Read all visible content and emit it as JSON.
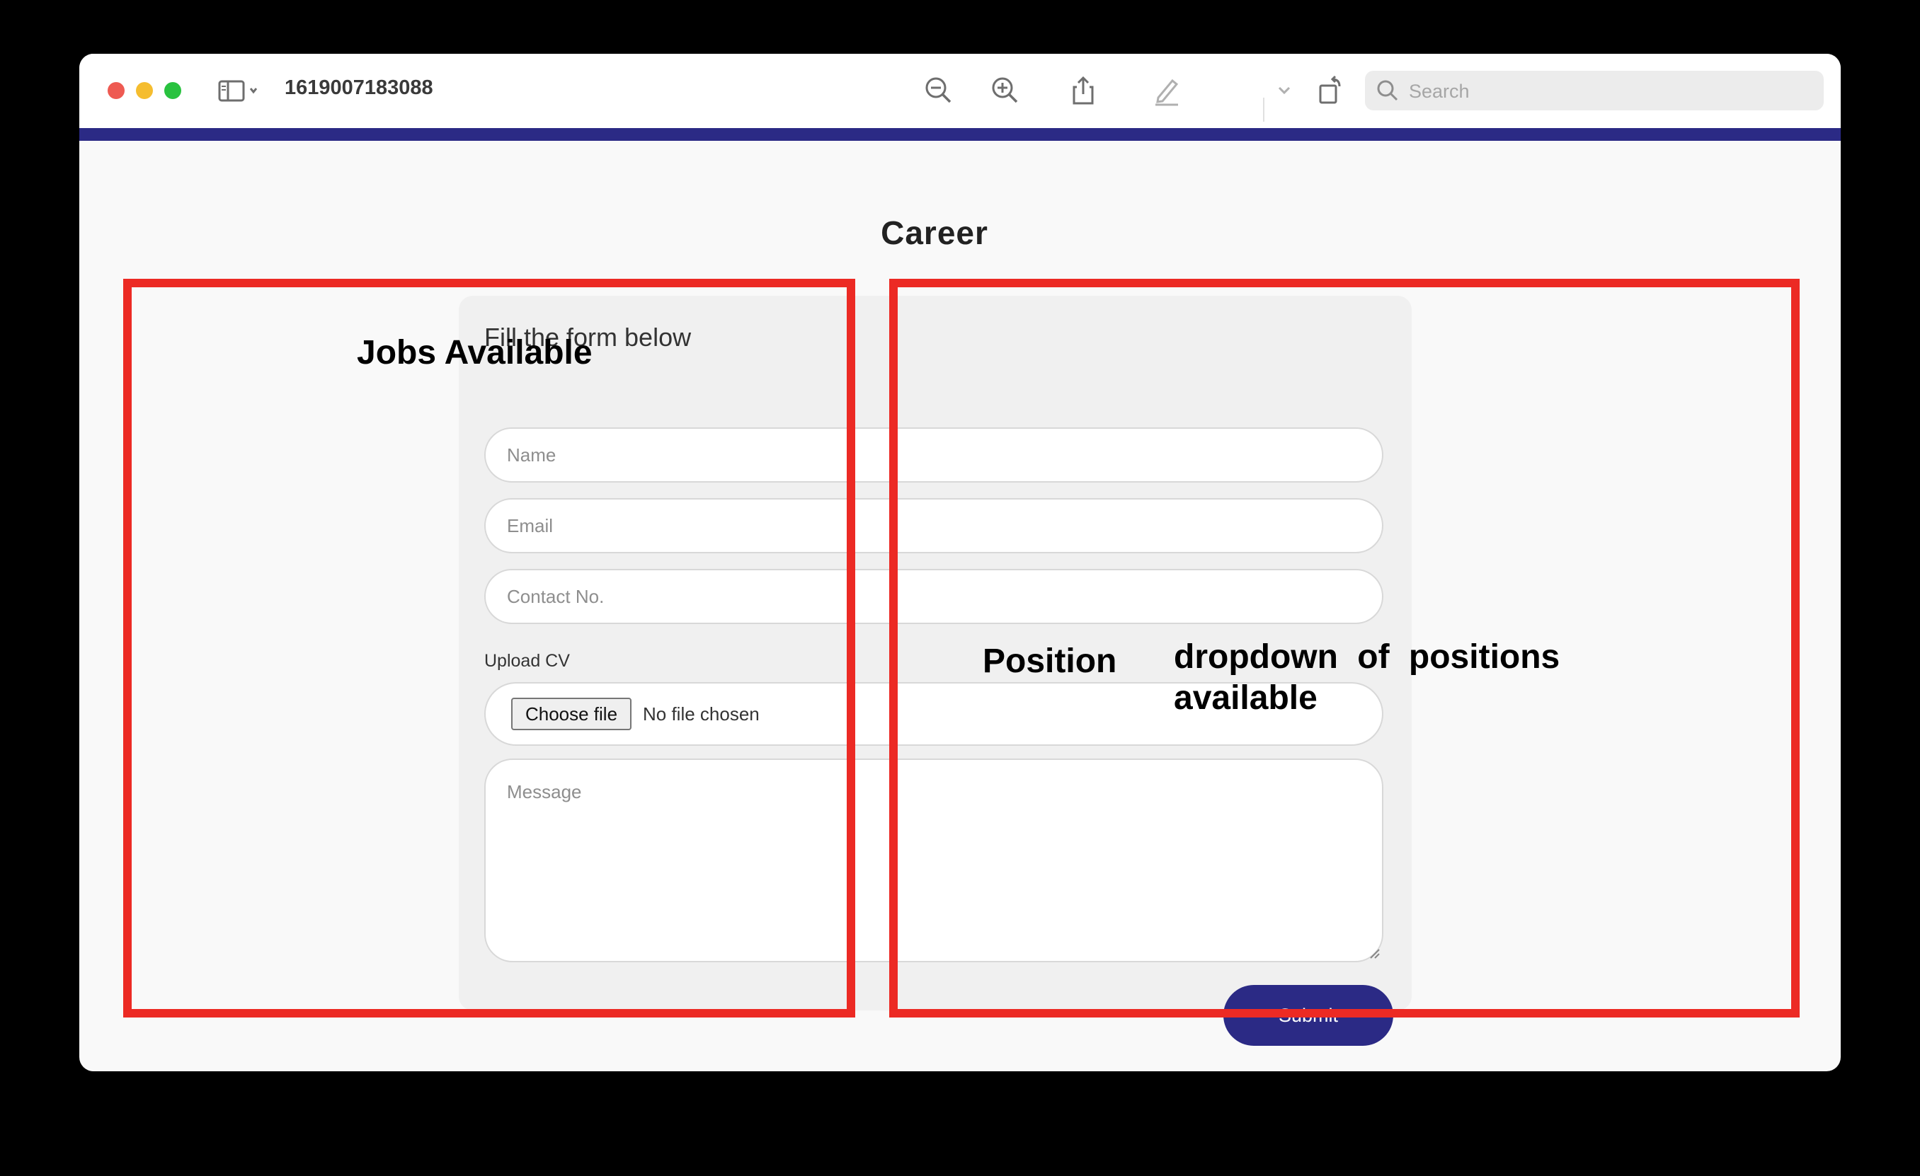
{
  "window": {
    "document_title": "1619007183088",
    "search_placeholder": "Search"
  },
  "toolbar": {
    "icons": [
      "sidebar-toggle-icon",
      "zoom-out-icon",
      "zoom-in-icon",
      "share-icon",
      "markup-pen-icon",
      "chevron-down-icon",
      "rotate-icon",
      "annotate-icon",
      "search-icon"
    ]
  },
  "page": {
    "title": "Career",
    "accent_color": "#2b2a85"
  },
  "form": {
    "heading": "Fill the form below",
    "name_placeholder": "Name",
    "email_placeholder": "Email",
    "contact_placeholder": "Contact No.",
    "upload_label": "Upload CV",
    "choose_file_label": "Choose file",
    "no_file_text": "No file chosen",
    "message_placeholder": "Message",
    "submit_label": "Submit"
  },
  "annotations": {
    "box_color": "#ec2a24",
    "left_label": "Jobs Available",
    "position_label": "Position",
    "dropdown_label": "dropdown of positions available"
  }
}
